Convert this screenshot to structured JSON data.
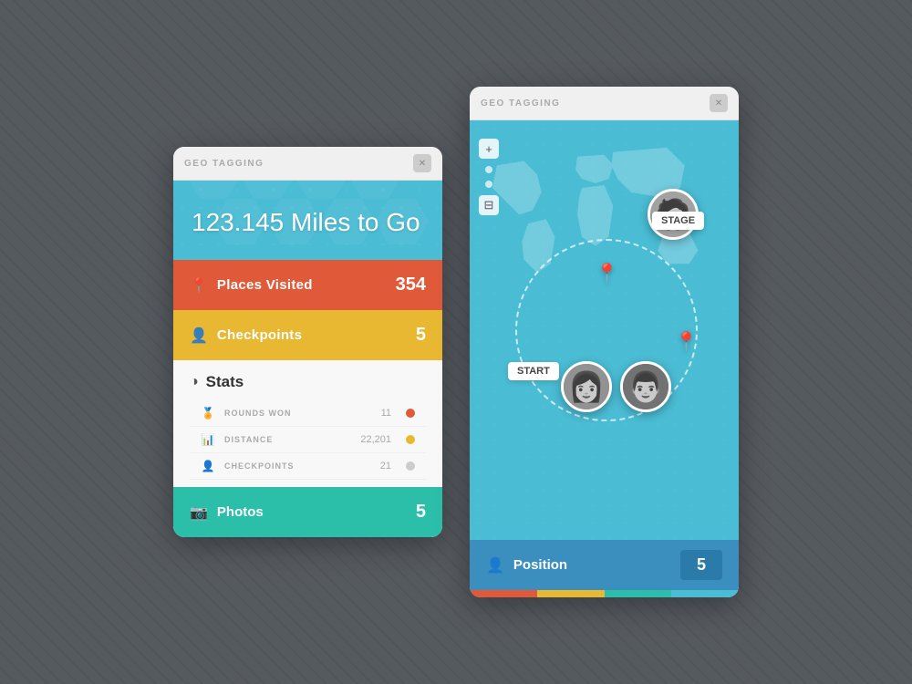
{
  "app": {
    "title": "GEO TAGGING",
    "close_label": "✕"
  },
  "card1": {
    "header_title": "GEO TAGGING",
    "hero_text": "123.145 Miles to Go",
    "places_label": "Places Visited",
    "places_value": "354",
    "checkpoints_label": "Checkpoints",
    "checkpoints_value": "5",
    "stats_title": "Stats",
    "stats": [
      {
        "icon": "🏆",
        "label": "ROUNDS WON",
        "value": "11",
        "dot": "red"
      },
      {
        "icon": "📈",
        "label": "DISTANCE",
        "value": "22,201",
        "dot": "yellow"
      },
      {
        "icon": "👤",
        "label": "CHECKPOINTS",
        "value": "21",
        "dot": "gray"
      }
    ],
    "photos_label": "Photos",
    "photos_value": "5"
  },
  "card2": {
    "header_title": "GEO TAGGING",
    "stage_label": "STAGE",
    "start_label": "START",
    "position_label": "Position",
    "position_value": "5"
  }
}
